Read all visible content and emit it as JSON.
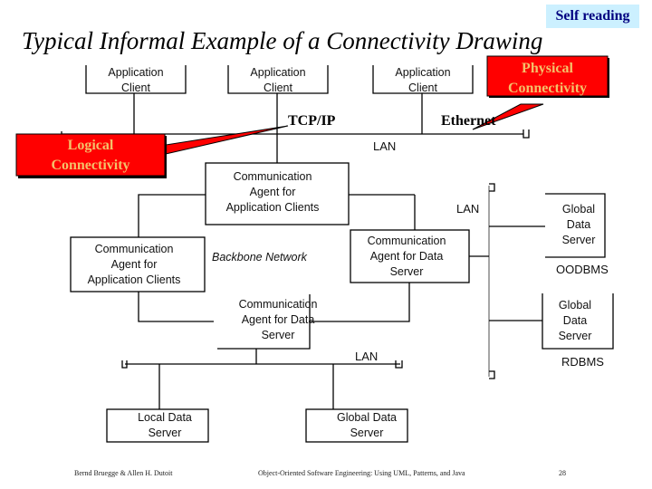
{
  "badge": "Self reading",
  "title": "Typical Informal Example of a Connectivity Drawing",
  "callouts": {
    "physical": [
      "Physical",
      "Connectivity"
    ],
    "logical": [
      "Logical",
      "Connectivity"
    ]
  },
  "colors": {
    "callout_fill": "#ff0000",
    "callout_text": "#f4c06a",
    "badge_bg": "#ccf0ff",
    "badge_text": "#000080"
  },
  "labels": {
    "tcpip": "TCP/IP",
    "ethernet": "Ethernet",
    "lan_top": "LAN",
    "lan_right": "LAN",
    "lan_bottom": "LAN",
    "backbone": "Backbone Network",
    "oodbms": "OODBMS",
    "rdbms": "RDBMS"
  },
  "nodes": {
    "app_client_1": [
      "Application",
      "Client"
    ],
    "app_client_2": [
      "Application",
      "Client"
    ],
    "app_client_3": [
      "Application",
      "Client"
    ],
    "comm_agent_app_1": [
      "Communication",
      "Agent for",
      "Application Clients"
    ],
    "comm_agent_app_2": [
      "Communication",
      "Agent for",
      "Application Clients"
    ],
    "comm_agent_data_1": [
      "Communication",
      "Agent for Data",
      "Server"
    ],
    "comm_agent_data_2": [
      "Communication",
      "Agent for Data",
      "Server"
    ],
    "global_data_server_oo": [
      "Global",
      "Data",
      "Server"
    ],
    "global_data_server_r": [
      "Global",
      "Data",
      "Server"
    ],
    "local_data_server": [
      "Local Data",
      "Server"
    ],
    "global_data_server_bottom": [
      "Global Data",
      "Server"
    ]
  },
  "footer": {
    "authors": "Bernd Bruegge & Allen H. Dutoit",
    "book": "Object-Oriented Software Engineering: Using UML, Patterns, and Java",
    "page": "28"
  }
}
